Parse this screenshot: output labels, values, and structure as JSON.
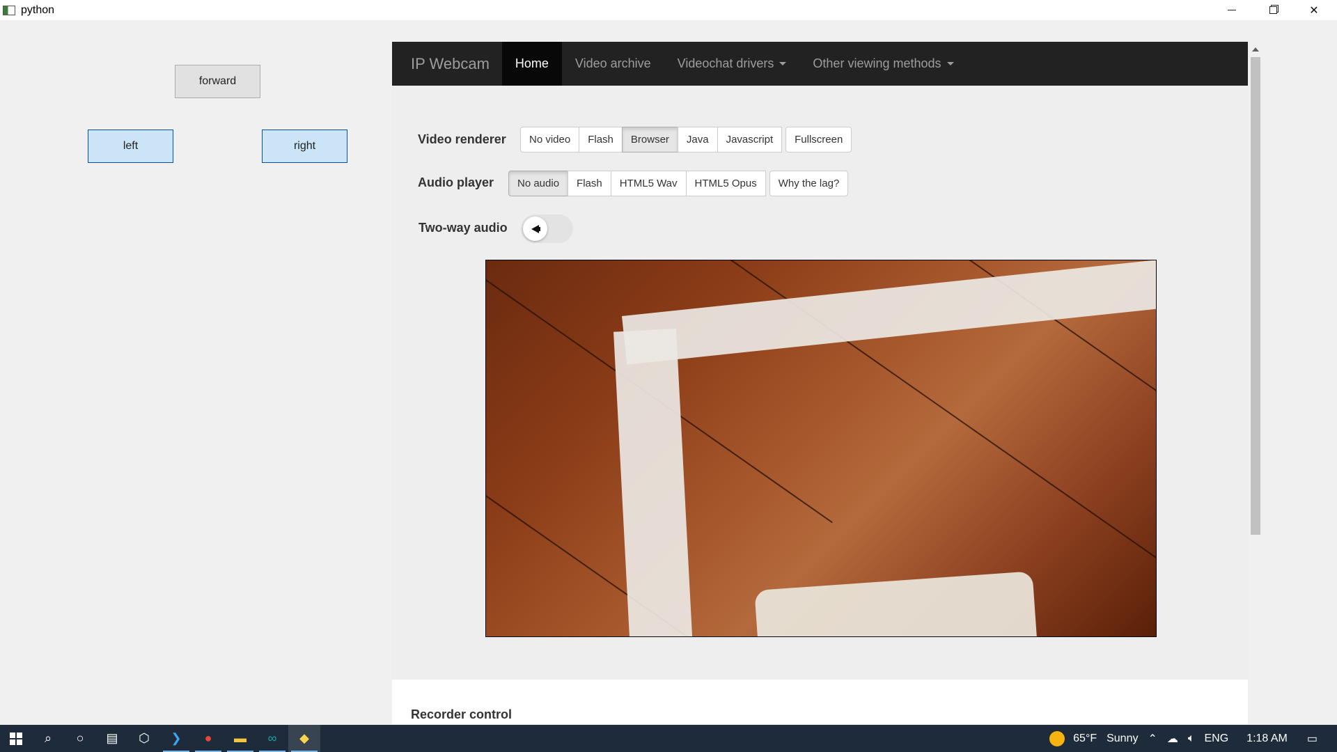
{
  "window": {
    "title": "python"
  },
  "controls": {
    "forward": "forward",
    "left": "left",
    "right": "right"
  },
  "webcam": {
    "nav": {
      "brand": "IP Webcam",
      "items": [
        {
          "label": "Home",
          "active": true
        },
        {
          "label": "Video archive",
          "active": false
        },
        {
          "label": "Videochat drivers",
          "dropdown": true
        },
        {
          "label": "Other viewing methods",
          "dropdown": true
        }
      ]
    },
    "video_renderer": {
      "label": "Video renderer",
      "options": [
        "No video",
        "Flash",
        "Browser",
        "Java",
        "Javascript"
      ],
      "selected": "Browser",
      "extra": "Fullscreen"
    },
    "audio_player": {
      "label": "Audio player",
      "options": [
        "No audio",
        "Flash",
        "HTML5 Wav",
        "HTML5 Opus"
      ],
      "selected": "No audio",
      "extra": "Why the lag?"
    },
    "two_way_audio": {
      "label": "Two-way audio",
      "enabled": false
    },
    "recorder": {
      "title": "Recorder control"
    }
  },
  "taskbar": {
    "weather": {
      "temp": "65°F",
      "condition": "Sunny"
    },
    "language": "ENG",
    "time": "1:18 AM"
  }
}
